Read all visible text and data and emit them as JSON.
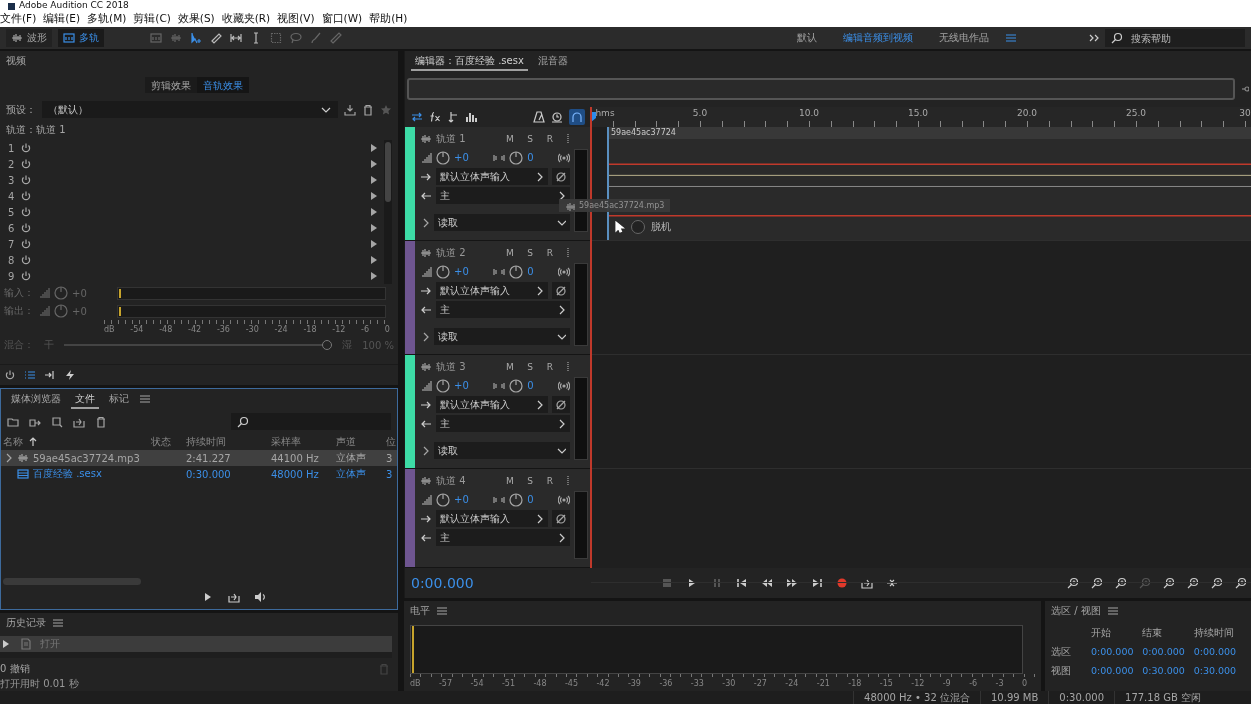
{
  "window": {
    "title": "Adobe Audition CC 2018"
  },
  "menu": [
    "文件(F)",
    "编辑(E)",
    "多轨(M)",
    "剪辑(C)",
    "效果(S)",
    "收藏夹(R)",
    "视图(V)",
    "窗口(W)",
    "帮助(H)"
  ],
  "toolbar": {
    "modes": [
      {
        "label": "波形",
        "selected": false
      },
      {
        "label": "多轨",
        "selected": true
      }
    ],
    "workspaces": [
      {
        "label": "默认",
        "selected": false
      },
      {
        "label": "编辑音频到视频",
        "selected": true
      },
      {
        "label": "无线电作品",
        "selected": false
      }
    ],
    "search": {
      "placeholder": "搜索帮助"
    }
  },
  "effects": {
    "panel_title": "视频",
    "tabs": [
      {
        "label": "剪辑效果",
        "selected": false
      },
      {
        "label": "音轨效果",
        "selected": true
      }
    ],
    "preset_label": "预设：",
    "preset_value": "（默认）",
    "track_label": "轨道：轨道 1",
    "slots": [
      "1",
      "2",
      "3",
      "4",
      "5",
      "6",
      "7",
      "8",
      "9"
    ],
    "io": [
      {
        "label": "输入：",
        "value": "+0"
      },
      {
        "label": "输出：",
        "value": "+0"
      }
    ],
    "scale": [
      "dB",
      "-54",
      "-48",
      "-42",
      "-36",
      "-30",
      "-24",
      "-18",
      "-12",
      "-6",
      "0"
    ],
    "mix": {
      "label": "混合：",
      "dry": "干",
      "wet": "湿",
      "reading": "100 %",
      "level": 1
    }
  },
  "files": {
    "tabs": [
      {
        "label": "媒体浏览器",
        "selected": false
      },
      {
        "label": "文件",
        "selected": true
      },
      {
        "label": "标记",
        "selected": false
      }
    ],
    "columns": [
      "名称",
      "状态",
      "持续时间",
      "采样率",
      "声道",
      "位"
    ],
    "rows": [
      {
        "kind": "audio",
        "name": "59ae45ac37724.mp3",
        "duration": "2:41.227",
        "rate": "44100 Hz",
        "channels": "立体声",
        "bits": "3",
        "selected": true,
        "active": false
      },
      {
        "kind": "session",
        "name": "百度经验 .sesx",
        "duration": "0:30.000",
        "rate": "48000 Hz",
        "channels": "立体声",
        "bits": "3",
        "selected": false,
        "active": true
      }
    ]
  },
  "history": {
    "title": "历史记录",
    "items": [
      {
        "label": "打开",
        "selected": true
      }
    ],
    "undo": "0 撤销",
    "status": "打开用时 0.01 秒"
  },
  "editor": {
    "tabs": [
      {
        "label": "编辑器：百度经验 .sesx",
        "selected": true
      },
      {
        "label": "混音器",
        "selected": false
      }
    ],
    "ruler": [
      "hms",
      "5.0",
      "10.0",
      "15.0",
      "20.0",
      "25.0",
      "30"
    ],
    "tracks": [
      {
        "name": "轨道 1",
        "color": "#3ddba6",
        "buttons": [
          "M",
          "S",
          "R"
        ],
        "volume": "+0",
        "pan": "0",
        "input": "默认立体声输入",
        "output": "主",
        "automation": "读取"
      },
      {
        "name": "轨道 2",
        "color": "#6e5590",
        "buttons": [
          "M",
          "S",
          "R"
        ],
        "volume": "+0",
        "pan": "0",
        "input": "默认立体声输入",
        "output": "主",
        "automation": "读取"
      },
      {
        "name": "轨道 3",
        "color": "#3ddba6",
        "buttons": [
          "M",
          "S",
          "R"
        ],
        "volume": "+0",
        "pan": "0",
        "input": "默认立体声输入",
        "output": "主",
        "automation": "读取"
      },
      {
        "name": "轨道 4",
        "color": "#6e5590",
        "buttons": [
          "M",
          "S",
          "R"
        ],
        "volume": "+0",
        "pan": "0",
        "input": "默认立体声输入",
        "output": "主"
      }
    ],
    "clip": {
      "title": "59ae45ac37724",
      "drag_label": "59ae45ac37724.mp3",
      "status": "脱机"
    },
    "time": "0:00.000"
  },
  "levels": {
    "title": "电平",
    "scale": [
      "dB",
      "-57",
      "-54",
      "-51",
      "-48",
      "-45",
      "-42",
      "-39",
      "-36",
      "-33",
      "-30",
      "-27",
      "-24",
      "-21",
      "-18",
      "-15",
      "-12",
      "-9",
      "-6",
      "-3",
      "0"
    ]
  },
  "selection_view": {
    "title": "选区 / 视图",
    "columns": [
      "开始",
      "结束",
      "持续时间"
    ],
    "rows": [
      {
        "label": "选区",
        "values": [
          "0:00.000",
          "0:00.000",
          "0:00.000"
        ]
      },
      {
        "label": "视图",
        "values": [
          "0:00.000",
          "0:30.000",
          "0:30.000"
        ]
      }
    ]
  },
  "status_bar": [
    "48000 Hz • 32 位混合",
    "10.99 MB",
    "0:30.000",
    "177.18 GB 空闲"
  ]
}
